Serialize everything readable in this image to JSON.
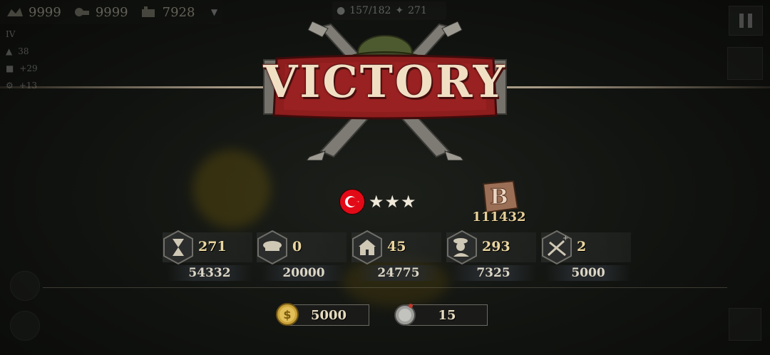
{
  "hud": {
    "resources": [
      {
        "icon": "supplies-icon",
        "value": "9999"
      },
      {
        "icon": "steel-icon",
        "value": "9999"
      },
      {
        "icon": "industry-icon",
        "value": "7928"
      }
    ],
    "population": "157/182",
    "units": "271"
  },
  "side_panel": {
    "rank": "IV",
    "rows": [
      "38",
      "+29",
      "+13"
    ]
  },
  "banner": {
    "title": "VICTORY"
  },
  "result": {
    "stars": "★★★",
    "score": "111432"
  },
  "stats": [
    {
      "icon": "hourglass-icon",
      "value": "271",
      "points": "54332"
    },
    {
      "icon": "officer-cap-icon",
      "value": "0",
      "points": "20000"
    },
    {
      "icon": "building-icon",
      "value": "45",
      "points": "24775"
    },
    {
      "icon": "general-icon",
      "value": "293",
      "points": "7325"
    },
    {
      "icon": "crossed-rifles-icon",
      "value": "2",
      "points": "5000"
    }
  ],
  "rewards": [
    {
      "icon": "gold-coin-icon",
      "value": "5000"
    },
    {
      "icon": "silver-medal-icon",
      "value": "15"
    }
  ],
  "colors": {
    "accent_gold": "#e7cf98",
    "banner_red": "#8e1d1d",
    "flag_red": "#e30a17"
  }
}
